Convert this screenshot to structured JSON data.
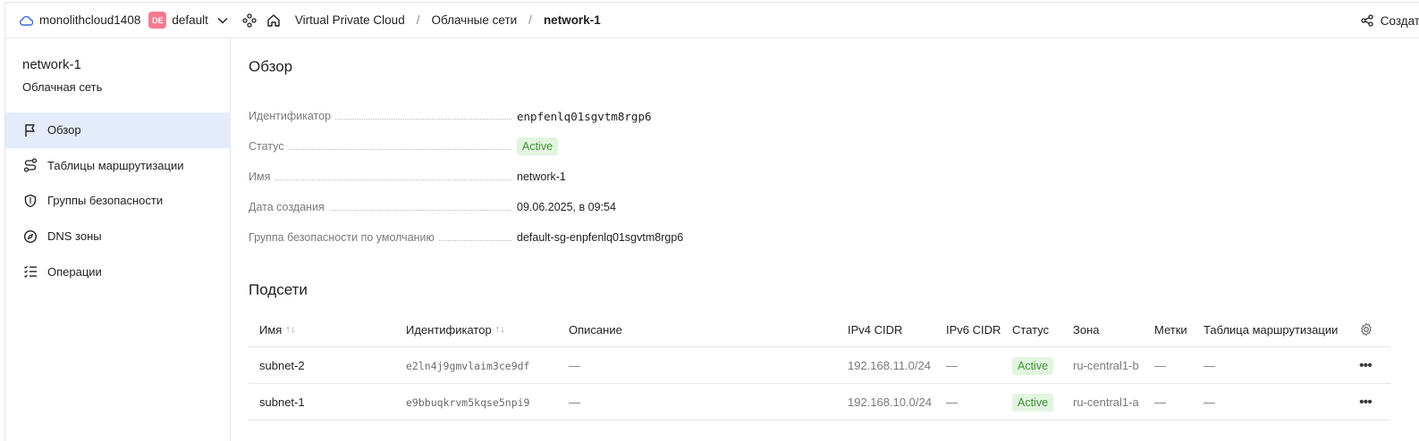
{
  "topbar": {
    "account": "monolithcloud1408",
    "folder_badge": "DE",
    "folder": "default",
    "breadcrumbs": [
      "Virtual Private Cloud",
      "Облачные сети",
      "network-1"
    ],
    "create_label": "Создат"
  },
  "sidebar": {
    "title": "network-1",
    "subtitle": "Облачная сеть",
    "items": [
      {
        "label": "Обзор",
        "icon": "flag-icon",
        "active": true
      },
      {
        "label": "Таблицы маршрутизации",
        "icon": "route-icon",
        "active": false
      },
      {
        "label": "Группы безопасности",
        "icon": "shield-icon",
        "active": false
      },
      {
        "label": "DNS зоны",
        "icon": "compass-icon",
        "active": false
      },
      {
        "label": "Операции",
        "icon": "list-check-icon",
        "active": false
      }
    ]
  },
  "overview": {
    "heading": "Обзор",
    "properties": [
      {
        "key": "Идентификатор",
        "value": "enpfenlq01sgvtm8rgp6"
      },
      {
        "key": "Статус",
        "value": "Active"
      },
      {
        "key": "Имя",
        "value": "network-1"
      },
      {
        "key": "Дата создания",
        "value": "09.06.2025, в 09:54"
      },
      {
        "key": "Группа безопасности по умолчанию",
        "value": "default-sg-enpfenlq01sgvtm8rgp6"
      }
    ]
  },
  "subnets": {
    "heading": "Подсети",
    "columns": [
      "Имя",
      "Идентификатор",
      "Описание",
      "IPv4 CIDR",
      "IPv6 CIDR",
      "Статус",
      "Зона",
      "Метки",
      "Таблица маршрутизации"
    ],
    "rows": [
      {
        "name": "subnet-2",
        "id": "e2ln4j9gmvlaim3ce9df",
        "description": "—",
        "ipv4": "192.168.11.0/24",
        "ipv6": "—",
        "status": "Active",
        "zone": "ru-central1-b",
        "labels": "—",
        "route_table": "—"
      },
      {
        "name": "subnet-1",
        "id": "e9bbuqkrvm5kqse5npi9",
        "description": "—",
        "ipv4": "192.168.10.0/24",
        "ipv6": "—",
        "status": "Active",
        "zone": "ru-central1-a",
        "labels": "—",
        "route_table": "—"
      }
    ]
  },
  "colors": {
    "accent": "#3a69d6",
    "active_nav_bg": "#e4ebfa",
    "status_bg": "#e2f5df",
    "status_text": "#3b9135",
    "badge_bg": "#f77a92"
  }
}
